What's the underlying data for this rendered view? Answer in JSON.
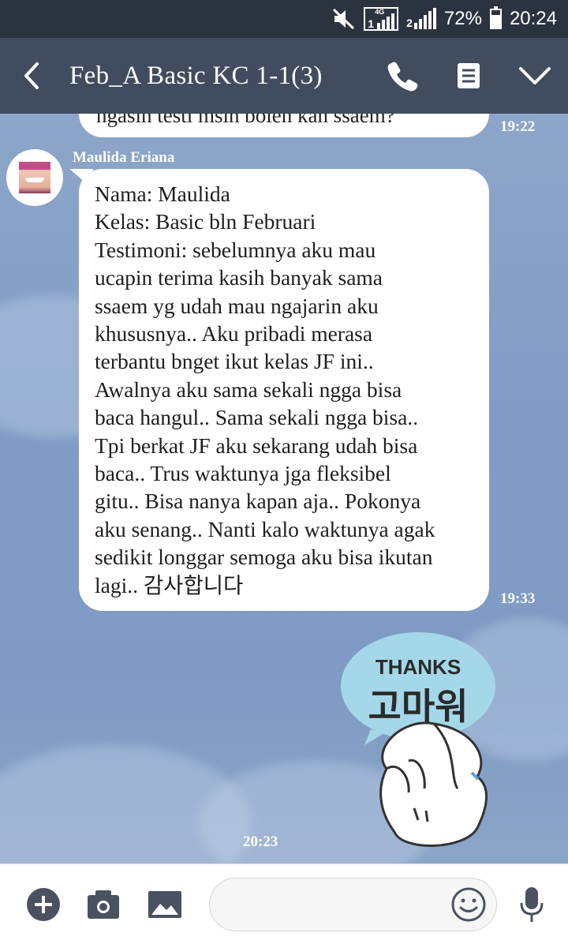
{
  "status_bar": {
    "network_label": "4G",
    "battery_level": 0.72,
    "battery_percent": "72%",
    "time": "20:24",
    "icons": [
      "mute-icon",
      "sim1-signal-icon",
      "sim2-signal-icon",
      "battery-icon"
    ]
  },
  "header": {
    "title": "Feb_A Basic KC 1-1(3)",
    "icons": [
      "back-icon",
      "phone-icon",
      "notes-icon",
      "chevron-down-icon"
    ]
  },
  "messages": {
    "previous": {
      "text": "ngasih testi msih boleh kan ssaem?",
      "time": "19:22"
    },
    "main": {
      "sender": "Maulida Eriana",
      "lines": [
        "Nama: Maulida",
        "Kelas: Basic bln Februari",
        "Testimoni: sebelumnya aku mau",
        "ucapin terima kasih banyak sama",
        "ssaem yg udah mau ngajarin aku",
        "khususnya.. Aku pribadi merasa",
        "terbantu bnget ikut kelas JF ini..",
        "Awalnya aku sama sekali ngga bisa",
        "baca hangul.. Sama sekali ngga bisa..",
        "Tpi berkat JF aku sekarang udah bisa",
        "baca.. Trus waktunya jga fleksibel",
        "gitu.. Bisa nanya kapan aja.. Pokonya",
        "aku senang.. Nanti kalo waktunya agak",
        "sedikit longgar semoga aku bisa ikutan",
        "lagi.. 감사합니다"
      ],
      "time": "19:33"
    },
    "sticker": {
      "text_top": "THANKS",
      "text_korean": "고마워",
      "time": "20:23"
    }
  },
  "input_bar": {
    "placeholder": "",
    "icons": [
      "add-icon",
      "camera-icon",
      "image-icon",
      "emoji-icon",
      "microphone-icon"
    ]
  },
  "colors": {
    "status_bar": "#2c3340",
    "header": "#424c5f",
    "chat_background": "#819dc5",
    "bubble": "#ffffff",
    "icon_gray": "#4a5261",
    "sticker_bubble": "#9fd6e6"
  }
}
